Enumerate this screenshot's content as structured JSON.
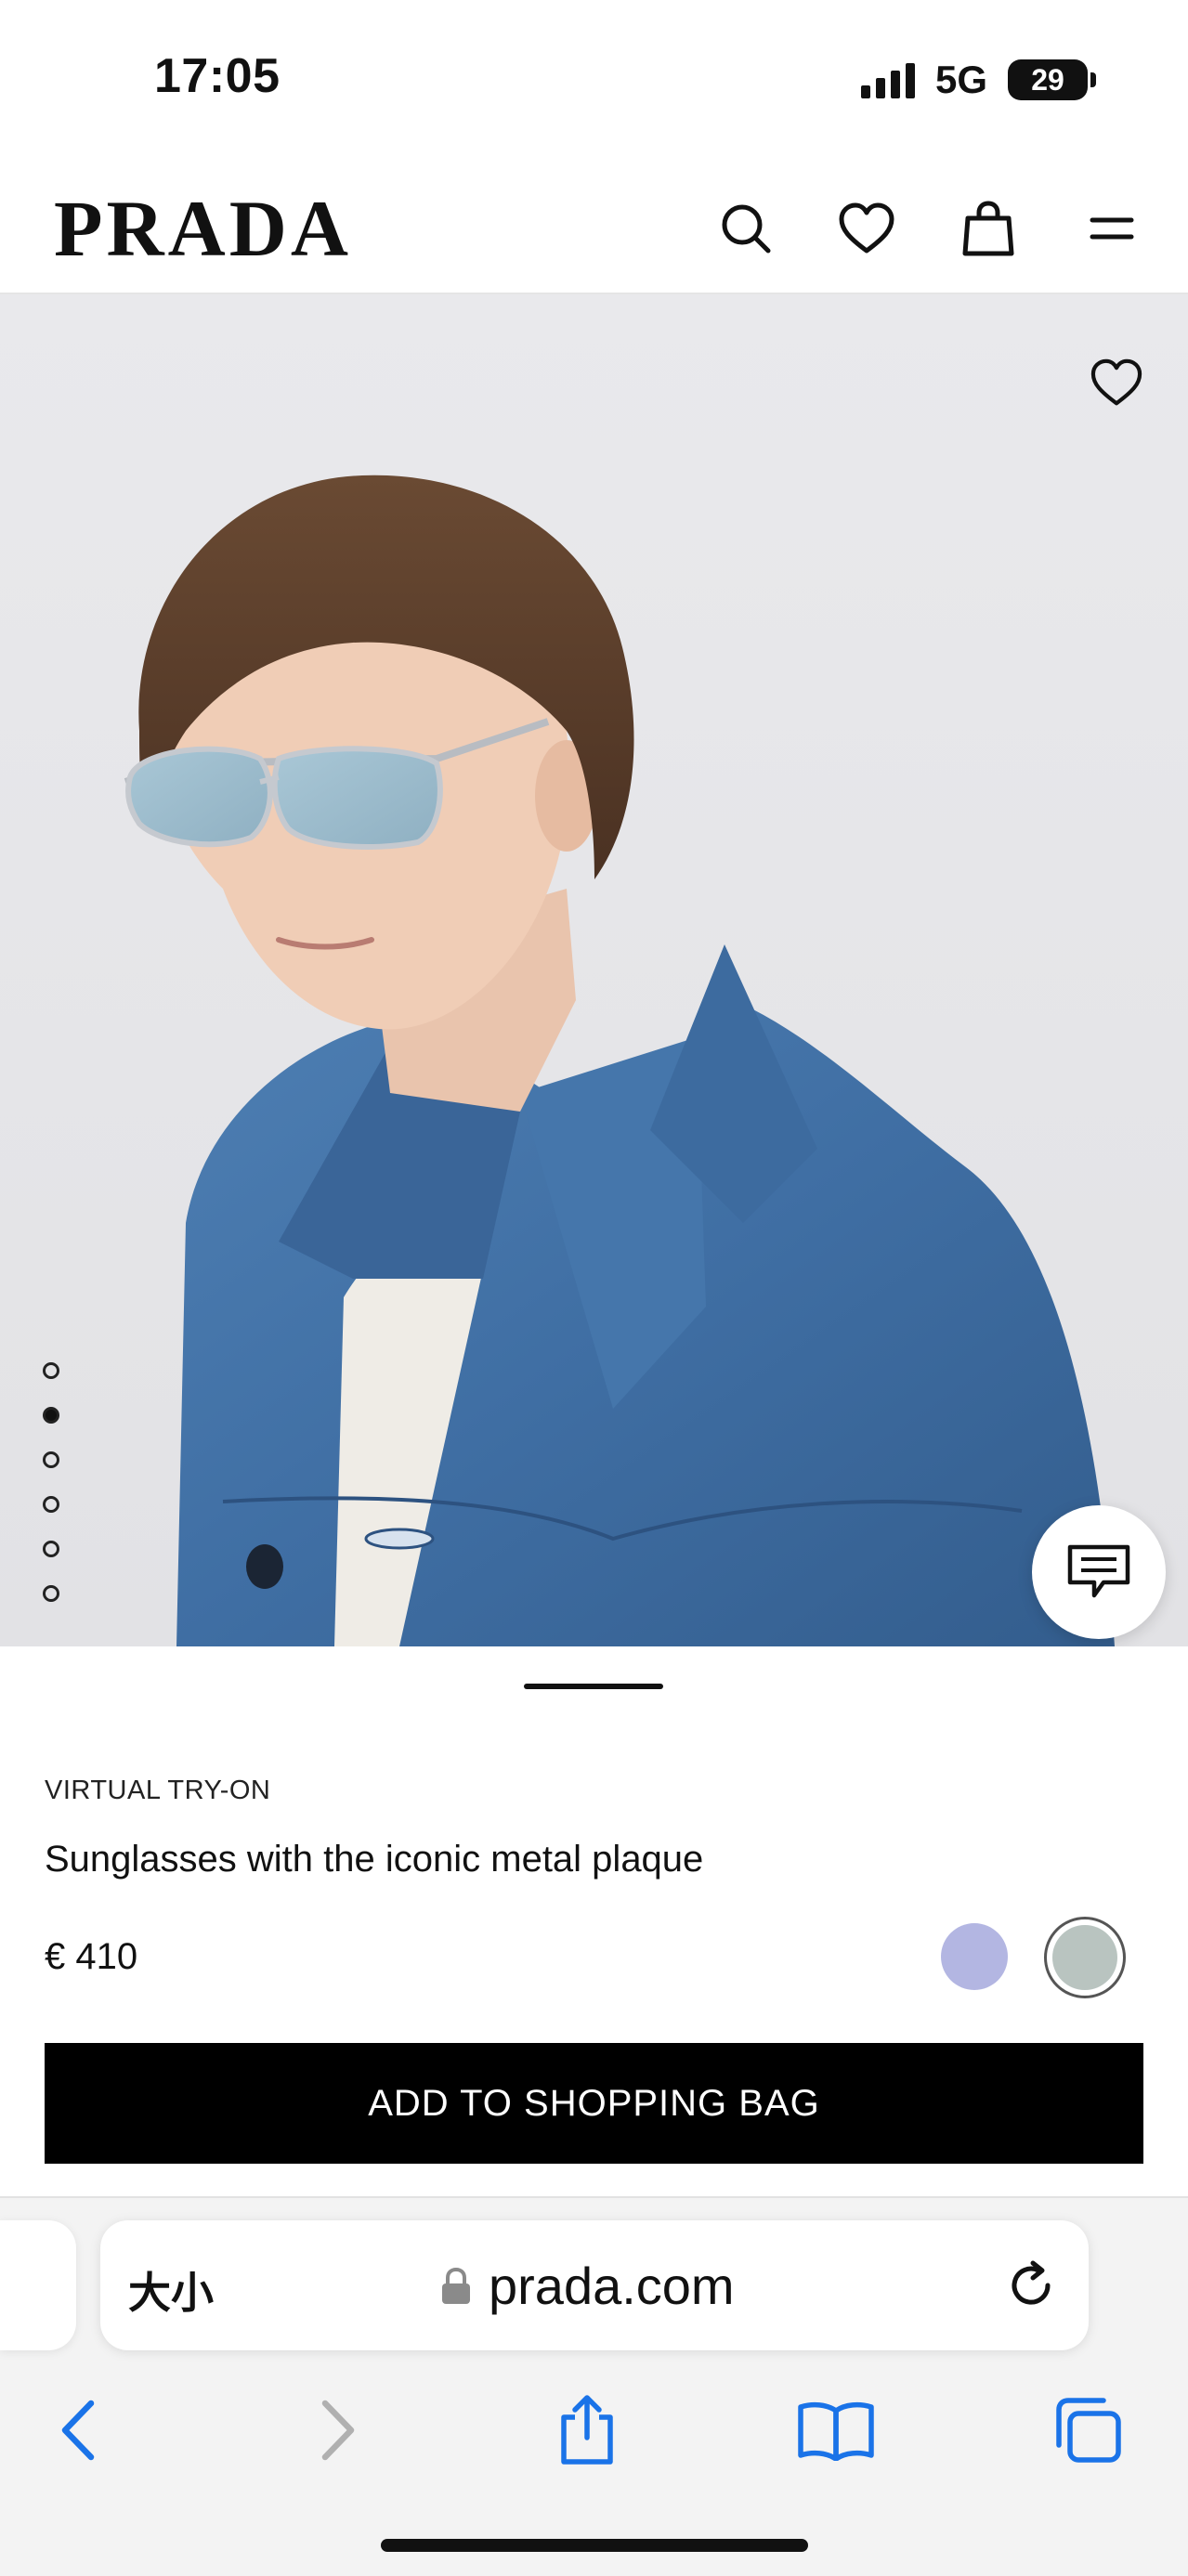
{
  "status_bar": {
    "time": "17:05",
    "network": "5G",
    "battery": "29"
  },
  "header": {
    "logo": "PRADA",
    "icons": [
      "search-icon",
      "heart-icon",
      "shopping-bag-icon",
      "menu-icon"
    ]
  },
  "gallery": {
    "dot_count": 6,
    "active_index": 1
  },
  "product": {
    "tag": "VIRTUAL TRY-ON",
    "title": "Sunglasses with the iconic metal plaque",
    "price": "€ 410",
    "swatches": [
      {
        "color": "#b3b6e2",
        "selected": false
      },
      {
        "color": "#b9c4c0",
        "selected": true
      }
    ],
    "add_to_bag_label": "ADD TO SHOPPING BAG"
  },
  "browser": {
    "text_size_label": "大小",
    "url": "prada.com",
    "accent_color": "#1a73e8"
  }
}
